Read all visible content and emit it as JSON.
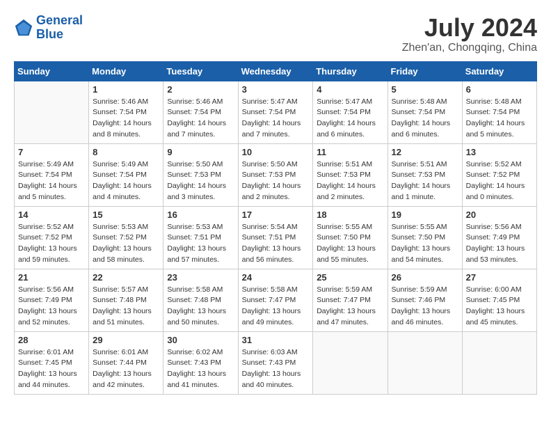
{
  "header": {
    "logo_line1": "General",
    "logo_line2": "Blue",
    "month_year": "July 2024",
    "location": "Zhen'an, Chongqing, China"
  },
  "days_of_week": [
    "Sunday",
    "Monday",
    "Tuesday",
    "Wednesday",
    "Thursday",
    "Friday",
    "Saturday"
  ],
  "weeks": [
    [
      {
        "day": "",
        "info": ""
      },
      {
        "day": "1",
        "info": "Sunrise: 5:46 AM\nSunset: 7:54 PM\nDaylight: 14 hours\nand 8 minutes."
      },
      {
        "day": "2",
        "info": "Sunrise: 5:46 AM\nSunset: 7:54 PM\nDaylight: 14 hours\nand 7 minutes."
      },
      {
        "day": "3",
        "info": "Sunrise: 5:47 AM\nSunset: 7:54 PM\nDaylight: 14 hours\nand 7 minutes."
      },
      {
        "day": "4",
        "info": "Sunrise: 5:47 AM\nSunset: 7:54 PM\nDaylight: 14 hours\nand 6 minutes."
      },
      {
        "day": "5",
        "info": "Sunrise: 5:48 AM\nSunset: 7:54 PM\nDaylight: 14 hours\nand 6 minutes."
      },
      {
        "day": "6",
        "info": "Sunrise: 5:48 AM\nSunset: 7:54 PM\nDaylight: 14 hours\nand 5 minutes."
      }
    ],
    [
      {
        "day": "7",
        "info": "Sunrise: 5:49 AM\nSunset: 7:54 PM\nDaylight: 14 hours\nand 5 minutes."
      },
      {
        "day": "8",
        "info": "Sunrise: 5:49 AM\nSunset: 7:54 PM\nDaylight: 14 hours\nand 4 minutes."
      },
      {
        "day": "9",
        "info": "Sunrise: 5:50 AM\nSunset: 7:53 PM\nDaylight: 14 hours\nand 3 minutes."
      },
      {
        "day": "10",
        "info": "Sunrise: 5:50 AM\nSunset: 7:53 PM\nDaylight: 14 hours\nand 2 minutes."
      },
      {
        "day": "11",
        "info": "Sunrise: 5:51 AM\nSunset: 7:53 PM\nDaylight: 14 hours\nand 2 minutes."
      },
      {
        "day": "12",
        "info": "Sunrise: 5:51 AM\nSunset: 7:53 PM\nDaylight: 14 hours\nand 1 minute."
      },
      {
        "day": "13",
        "info": "Sunrise: 5:52 AM\nSunset: 7:52 PM\nDaylight: 14 hours\nand 0 minutes."
      }
    ],
    [
      {
        "day": "14",
        "info": "Sunrise: 5:52 AM\nSunset: 7:52 PM\nDaylight: 13 hours\nand 59 minutes."
      },
      {
        "day": "15",
        "info": "Sunrise: 5:53 AM\nSunset: 7:52 PM\nDaylight: 13 hours\nand 58 minutes."
      },
      {
        "day": "16",
        "info": "Sunrise: 5:53 AM\nSunset: 7:51 PM\nDaylight: 13 hours\nand 57 minutes."
      },
      {
        "day": "17",
        "info": "Sunrise: 5:54 AM\nSunset: 7:51 PM\nDaylight: 13 hours\nand 56 minutes."
      },
      {
        "day": "18",
        "info": "Sunrise: 5:55 AM\nSunset: 7:50 PM\nDaylight: 13 hours\nand 55 minutes."
      },
      {
        "day": "19",
        "info": "Sunrise: 5:55 AM\nSunset: 7:50 PM\nDaylight: 13 hours\nand 54 minutes."
      },
      {
        "day": "20",
        "info": "Sunrise: 5:56 AM\nSunset: 7:49 PM\nDaylight: 13 hours\nand 53 minutes."
      }
    ],
    [
      {
        "day": "21",
        "info": "Sunrise: 5:56 AM\nSunset: 7:49 PM\nDaylight: 13 hours\nand 52 minutes."
      },
      {
        "day": "22",
        "info": "Sunrise: 5:57 AM\nSunset: 7:48 PM\nDaylight: 13 hours\nand 51 minutes."
      },
      {
        "day": "23",
        "info": "Sunrise: 5:58 AM\nSunset: 7:48 PM\nDaylight: 13 hours\nand 50 minutes."
      },
      {
        "day": "24",
        "info": "Sunrise: 5:58 AM\nSunset: 7:47 PM\nDaylight: 13 hours\nand 49 minutes."
      },
      {
        "day": "25",
        "info": "Sunrise: 5:59 AM\nSunset: 7:47 PM\nDaylight: 13 hours\nand 47 minutes."
      },
      {
        "day": "26",
        "info": "Sunrise: 5:59 AM\nSunset: 7:46 PM\nDaylight: 13 hours\nand 46 minutes."
      },
      {
        "day": "27",
        "info": "Sunrise: 6:00 AM\nSunset: 7:45 PM\nDaylight: 13 hours\nand 45 minutes."
      }
    ],
    [
      {
        "day": "28",
        "info": "Sunrise: 6:01 AM\nSunset: 7:45 PM\nDaylight: 13 hours\nand 44 minutes."
      },
      {
        "day": "29",
        "info": "Sunrise: 6:01 AM\nSunset: 7:44 PM\nDaylight: 13 hours\nand 42 minutes."
      },
      {
        "day": "30",
        "info": "Sunrise: 6:02 AM\nSunset: 7:43 PM\nDaylight: 13 hours\nand 41 minutes."
      },
      {
        "day": "31",
        "info": "Sunrise: 6:03 AM\nSunset: 7:43 PM\nDaylight: 13 hours\nand 40 minutes."
      },
      {
        "day": "",
        "info": ""
      },
      {
        "day": "",
        "info": ""
      },
      {
        "day": "",
        "info": ""
      }
    ]
  ]
}
